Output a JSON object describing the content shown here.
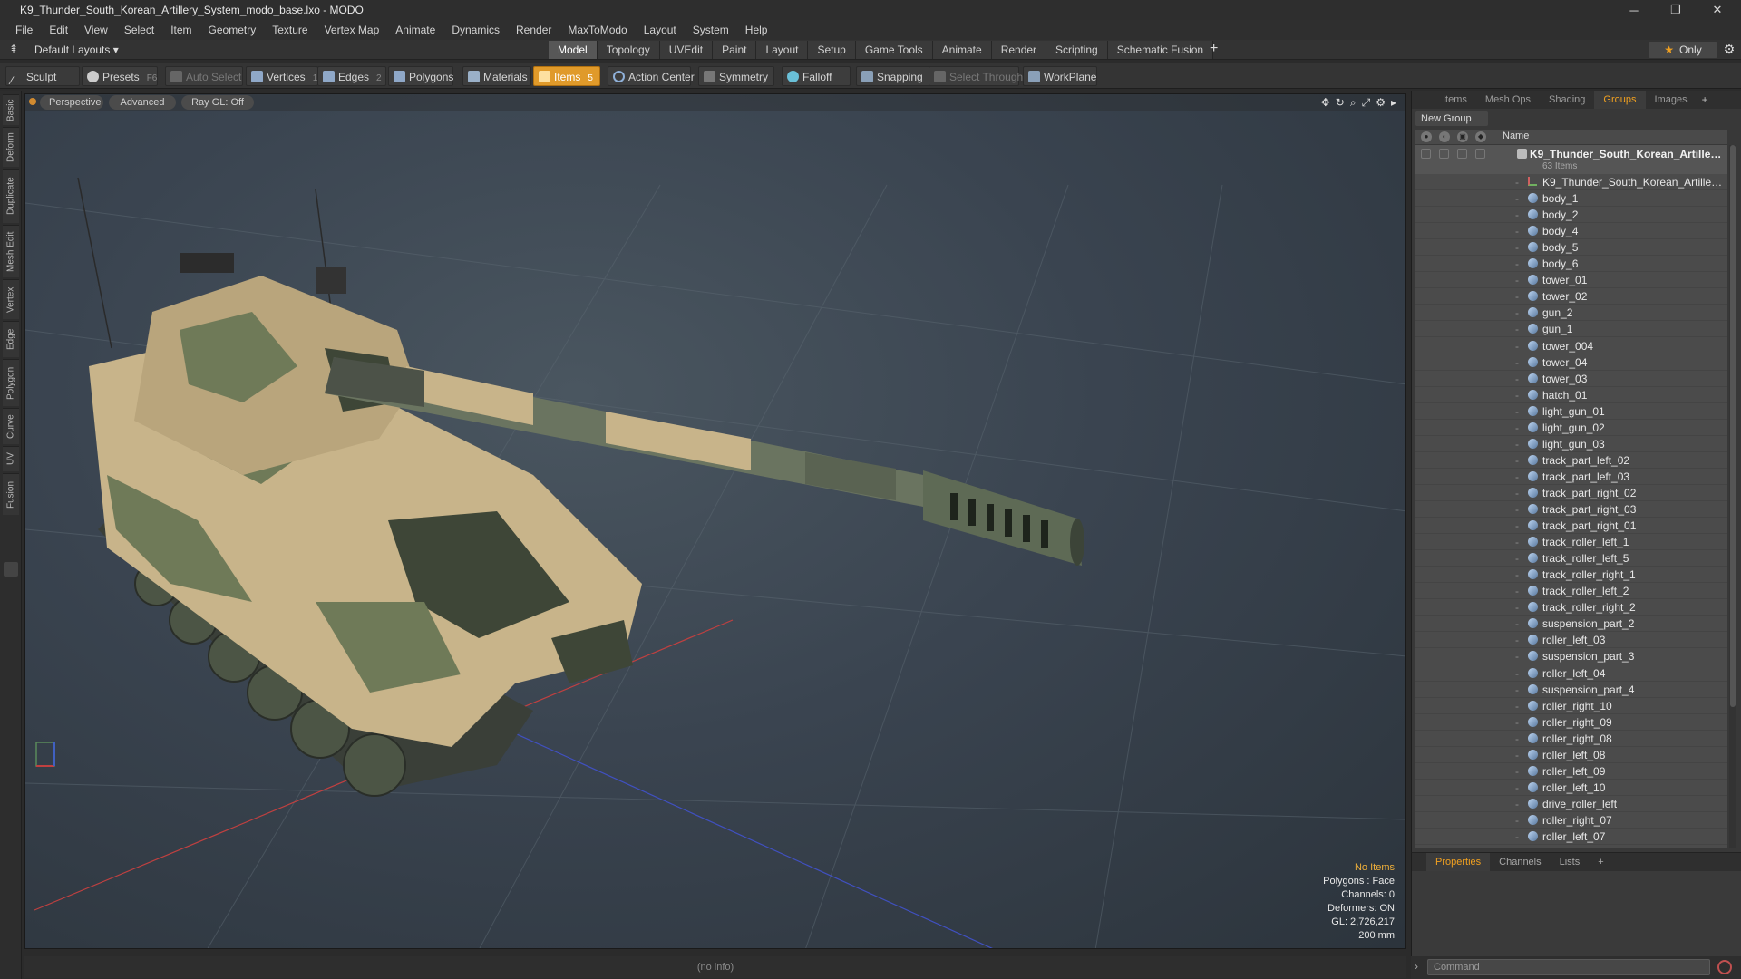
{
  "window": {
    "title": "K9_Thunder_South_Korean_Artillery_System_modo_base.lxo - MODO",
    "minimize": "─",
    "maximize": "❐",
    "close": "✕"
  },
  "menu": [
    "File",
    "Edit",
    "View",
    "Select",
    "Item",
    "Geometry",
    "Texture",
    "Vertex Map",
    "Animate",
    "Dynamics",
    "Render",
    "MaxToModo",
    "Layout",
    "System",
    "Help"
  ],
  "layout": {
    "default_layouts": "Default Layouts ▾",
    "tabs": [
      "Model",
      "Topology",
      "UVEdit",
      "Paint",
      "Layout",
      "Setup",
      "Game Tools",
      "Animate",
      "Render",
      "Scripting",
      "Schematic Fusion"
    ],
    "active_tab": "Model",
    "add": "+",
    "only": "Only"
  },
  "toolbar": {
    "sculpt": "Sculpt",
    "presets": "Presets",
    "presets_key": "F6",
    "auto_select": "Auto Select",
    "vertices": "Vertices",
    "vertices_key": "1",
    "edges": "Edges",
    "edges_key": "2",
    "polygons": "Polygons",
    "materials": "Materials",
    "items": "Items",
    "items_key": "5",
    "action_center": "Action Center",
    "symmetry": "Symmetry",
    "falloff": "Falloff",
    "snapping": "Snapping",
    "select_through": "Select Through",
    "workplane": "WorkPlane"
  },
  "left_tabs": [
    "Basic",
    "Deform",
    "Duplicate",
    "Mesh Edit",
    "Vertex",
    "Edge",
    "Polygon",
    "Curve",
    "UV",
    "Fusion"
  ],
  "viewport": {
    "perspective": "Perspective",
    "advanced": "Advanced",
    "raygl": "Ray GL: Off",
    "info": {
      "no_items": "No Items",
      "polygons": "Polygons : Face",
      "channels": "Channels: 0",
      "deformers": "Deformers: ON",
      "gl": "GL: 2,726,217",
      "scale": "200 mm"
    },
    "colors": {
      "axis_x": "#c04040",
      "axis_z": "#4050c0",
      "camo_tan": "#c8b48a",
      "camo_green": "#6f7a58",
      "camo_dark": "#3e4637",
      "barrel_green": "#6a7460"
    }
  },
  "status": "(no info)",
  "panel": {
    "tabs": [
      "Items",
      "Mesh Ops",
      "Shading",
      "Groups",
      "Images"
    ],
    "active_tab": "Groups",
    "add": "+",
    "new_group": "New Group",
    "name_header": "Name",
    "group": {
      "name": "K9_Thunder_South_Korean_Artiller ...",
      "count": "63 Items"
    },
    "rows": [
      {
        "name": "K9_Thunder_South_Korean_Artillery_Sy...",
        "type": "locator"
      },
      {
        "name": "body_1",
        "type": "mesh"
      },
      {
        "name": "body_2",
        "type": "mesh"
      },
      {
        "name": "body_4",
        "type": "mesh"
      },
      {
        "name": "body_5",
        "type": "mesh"
      },
      {
        "name": "body_6",
        "type": "mesh"
      },
      {
        "name": "tower_01",
        "type": "mesh"
      },
      {
        "name": "tower_02",
        "type": "mesh"
      },
      {
        "name": "gun_2",
        "type": "mesh"
      },
      {
        "name": "gun_1",
        "type": "mesh"
      },
      {
        "name": "tower_004",
        "type": "mesh"
      },
      {
        "name": "tower_04",
        "type": "mesh"
      },
      {
        "name": "tower_03",
        "type": "mesh"
      },
      {
        "name": "hatch_01",
        "type": "mesh"
      },
      {
        "name": "light_gun_01",
        "type": "mesh"
      },
      {
        "name": "light_gun_02",
        "type": "mesh"
      },
      {
        "name": "light_gun_03",
        "type": "mesh"
      },
      {
        "name": "track_part_left_02",
        "type": "mesh"
      },
      {
        "name": "track_part_left_03",
        "type": "mesh"
      },
      {
        "name": "track_part_right_02",
        "type": "mesh"
      },
      {
        "name": "track_part_right_03",
        "type": "mesh"
      },
      {
        "name": "track_part_right_01",
        "type": "mesh"
      },
      {
        "name": "track_roller_left_1",
        "type": "mesh"
      },
      {
        "name": "track_roller_left_5",
        "type": "mesh"
      },
      {
        "name": "track_roller_right_1",
        "type": "mesh"
      },
      {
        "name": "track_roller_left_2",
        "type": "mesh"
      },
      {
        "name": "track_roller_right_2",
        "type": "mesh"
      },
      {
        "name": "suspension_part_2",
        "type": "mesh"
      },
      {
        "name": "roller_left_03",
        "type": "mesh"
      },
      {
        "name": "suspension_part_3",
        "type": "mesh"
      },
      {
        "name": "roller_left_04",
        "type": "mesh"
      },
      {
        "name": "suspension_part_4",
        "type": "mesh"
      },
      {
        "name": "roller_right_10",
        "type": "mesh"
      },
      {
        "name": "roller_right_09",
        "type": "mesh"
      },
      {
        "name": "roller_right_08",
        "type": "mesh"
      },
      {
        "name": "roller_left_08",
        "type": "mesh"
      },
      {
        "name": "roller_left_09",
        "type": "mesh"
      },
      {
        "name": "roller_left_10",
        "type": "mesh"
      },
      {
        "name": "drive_roller_left",
        "type": "mesh"
      },
      {
        "name": "roller_right_07",
        "type": "mesh"
      },
      {
        "name": "roller_left_07",
        "type": "mesh"
      }
    ]
  },
  "props": {
    "tabs": [
      "Properties",
      "Channels",
      "Lists"
    ],
    "active_tab": "Properties",
    "add": "+"
  },
  "command": {
    "placeholder": "Command"
  }
}
